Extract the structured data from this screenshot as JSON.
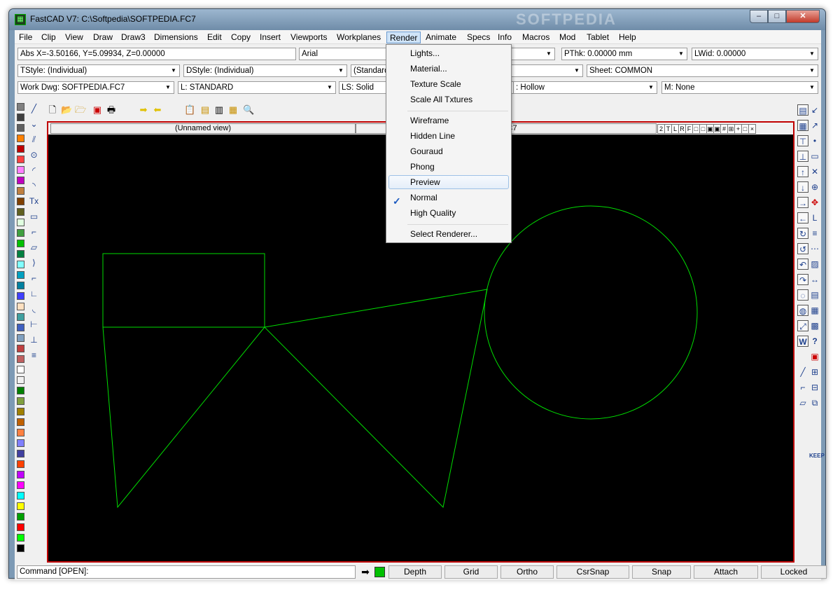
{
  "window": {
    "title": "FastCAD V7: C:\\Softpedia\\SOFTPEDIA.FC7",
    "watermark": "SOFTPEDIA",
    "min_glyph": "–",
    "max_glyph": "□",
    "close_glyph": "✕"
  },
  "menubar": [
    "File",
    "Clip",
    "View",
    "Draw",
    "Draw3",
    "Dimensions",
    "Edit",
    "Copy",
    "Insert",
    "Viewports",
    "Workplanes",
    "Render",
    "Animate",
    "Specs",
    "Info",
    "Macros",
    "Mod",
    "Tablet",
    "Help"
  ],
  "fields": {
    "coords": "Abs X=-3.50166, Y=5.09934, Z=0.00000",
    "font": "Arial",
    "pthk": "PThk: 0.00000 mm",
    "lwid": "LWid: 0.00000",
    "tstyle": "TStyle: (Individual)",
    "dstyle": "DStyle: (Individual)",
    "standard": "(Standard",
    "sheet": "Sheet: COMMON",
    "workdwg": "Work Dwg: SOFTPEDIA.FC7",
    "layer": "L: STANDARD",
    "linestyle": "LS: Solid",
    "fill": ": Hollow",
    "material": "M: None"
  },
  "viewport": {
    "left_name": "(Unnamed view)",
    "right_name": "A.FC7",
    "buttons": [
      "2",
      "T",
      "L",
      "R",
      "F",
      "□",
      "□",
      "▣",
      "▣",
      "#",
      "⊞",
      "+",
      "□",
      "×"
    ]
  },
  "render_menu": {
    "groups": [
      [
        "Lights...",
        "Material...",
        "Texture Scale",
        "Scale All Txtures"
      ],
      [
        "Wireframe",
        "Hidden Line",
        "Gouraud",
        "Phong",
        "Preview",
        "Normal",
        "High Quality"
      ],
      [
        "Select Renderer..."
      ]
    ],
    "highlighted": "Preview",
    "checked": "Normal",
    "check_glyph": "✓"
  },
  "statusbar": {
    "command": "Command [OPEN]:",
    "arrow_glyph": "➡",
    "buttons": [
      "Depth",
      "Grid",
      "Ortho",
      "CsrSnap",
      "Snap",
      "Attach",
      "Locked"
    ]
  },
  "colors": {
    "palette": [
      "#808080",
      "#404040",
      "#606060",
      "#ff8000",
      "#c00000",
      "#ff4040",
      "#ff80ff",
      "#c000c0",
      "#c08040",
      "#804000",
      "#606020",
      "#e0ffe0",
      "#40a040",
      "#00c000",
      "#008040",
      "#80ffff",
      "#00a0c0",
      "#0080a0",
      "#4040ff",
      "#ffe0c0",
      "#40a0a0",
      "#4060c0",
      "#80a0c0",
      "#c04040",
      "#c06060",
      "#ffffff",
      "#f0f0f0",
      "#008000",
      "#80a040",
      "#a08000",
      "#c06000",
      "#ff8040",
      "#8080ff",
      "#4040a0",
      "#ff4000",
      "#c000ff",
      "#ff00ff",
      "#00ffff",
      "#ffff00",
      "#00a000",
      "#ff0000",
      "#00ff00",
      "#000000"
    ],
    "drawing_line": "#00dd00",
    "viewport_border": "#c00000",
    "status_color": "#00c000"
  }
}
